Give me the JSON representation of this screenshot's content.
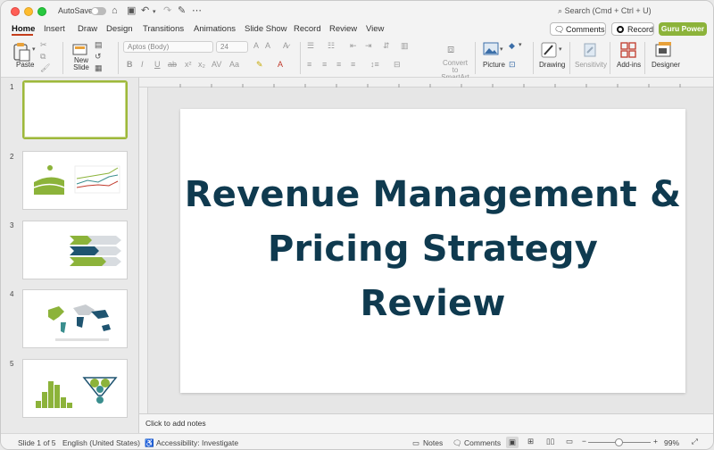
{
  "titlebar": {
    "autosave_label": "AutoSave",
    "search_placeholder": "Search (Cmd + Ctrl + U)"
  },
  "tabs": [
    "Home",
    "Insert",
    "Draw",
    "Design",
    "Transitions",
    "Animations",
    "Slide Show",
    "Record",
    "Review",
    "View"
  ],
  "actions": {
    "comments": "Comments",
    "record": "Record",
    "guru": "Guru Power"
  },
  "ribbon": {
    "paste": "Paste",
    "new_slide": "New Slide",
    "font_name": "Aptos (Body)",
    "font_size": "24",
    "convert_smartart_1": "Convert to",
    "convert_smartart_2": "SmartArt",
    "picture": "Picture",
    "drawing": "Drawing",
    "sensitivity": "Sensitivity",
    "addins": "Add-ins",
    "designer": "Designer"
  },
  "slides": [
    {
      "num": "1"
    },
    {
      "num": "2"
    },
    {
      "num": "3"
    },
    {
      "num": "4"
    },
    {
      "num": "5"
    }
  ],
  "slide": {
    "title_line1": "Revenue Management &",
    "title_line2": "Pricing Strategy",
    "title_line3": "Review"
  },
  "notes_placeholder": "Click to add notes",
  "status": {
    "slide_of": "Slide 1 of 5",
    "language": "English (United States)",
    "accessibility": "Accessibility: Investigate",
    "notes": "Notes",
    "comments": "Comments",
    "zoom": "99%"
  },
  "colors": {
    "accent_green": "#8cb33a",
    "title_navy": "#0f3a4f",
    "tab_underline": "#c43e1c"
  }
}
